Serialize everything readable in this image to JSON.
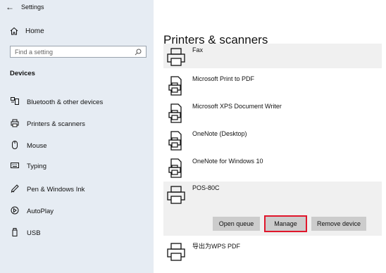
{
  "window": {
    "back_glyph": "←",
    "title": "Settings"
  },
  "sidebar": {
    "home_label": "Home",
    "search_placeholder": "Find a setting",
    "section_label": "Devices",
    "items": [
      {
        "label": "Bluetooth & other devices",
        "icon": "bluetooth-devices-icon"
      },
      {
        "label": "Printers & scanners",
        "icon": "printer-icon"
      },
      {
        "label": "Mouse",
        "icon": "mouse-icon"
      },
      {
        "label": "Typing",
        "icon": "keyboard-icon"
      },
      {
        "label": "Pen & Windows Ink",
        "icon": "pen-icon"
      },
      {
        "label": "AutoPlay",
        "icon": "autoplay-icon"
      },
      {
        "label": "USB",
        "icon": "usb-icon"
      }
    ]
  },
  "main": {
    "title": "Printers & scanners",
    "printers": [
      {
        "name": "Fax"
      },
      {
        "name": "Microsoft Print to PDF"
      },
      {
        "name": "Microsoft XPS Document Writer"
      },
      {
        "name": "OneNote (Desktop)"
      },
      {
        "name": "OneNote for Windows 10"
      },
      {
        "name": "POS-80C"
      },
      {
        "name": "导出为WPS PDF"
      }
    ],
    "actions": {
      "open_queue": "Open queue",
      "manage": "Manage",
      "remove_device": "Remove device"
    }
  },
  "colors": {
    "sidebar_bg": "#e6ecf3",
    "selected_row_bg": "#f0f0f0",
    "button_bg": "#cccccc",
    "highlight": "#e0162b"
  }
}
